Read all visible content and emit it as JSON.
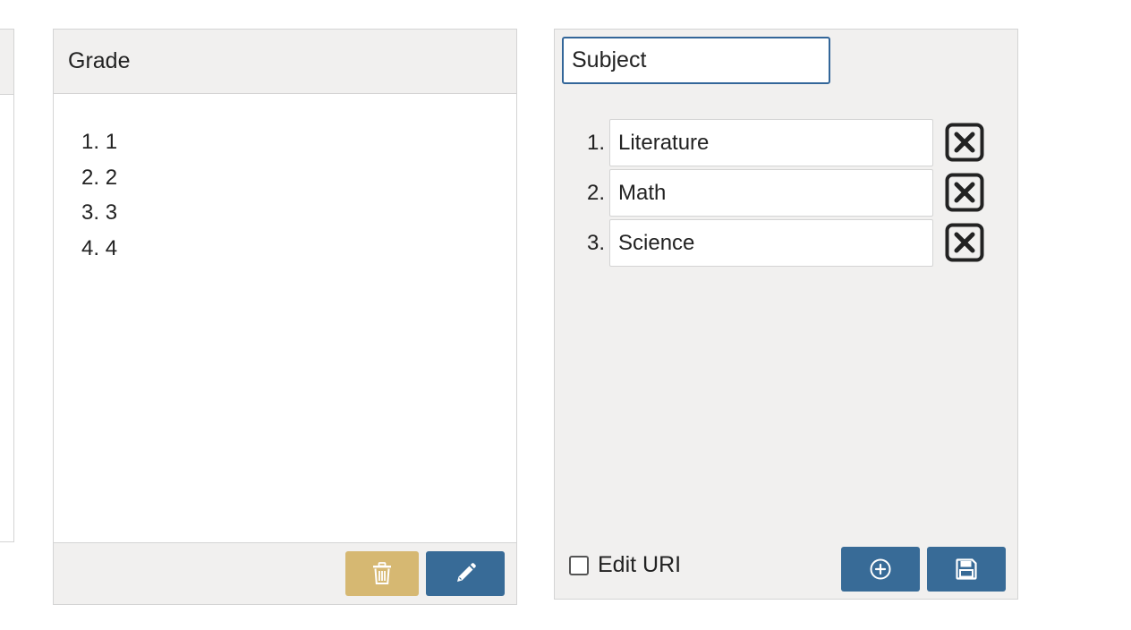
{
  "grade_panel": {
    "title": "Grade",
    "items": [
      {
        "number": "1.",
        "label": "1"
      },
      {
        "number": "2.",
        "label": "2"
      },
      {
        "number": "3.",
        "label": "3"
      },
      {
        "number": "4.",
        "label": "4"
      }
    ],
    "delete_icon": "trash-icon",
    "edit_icon": "pencil-icon"
  },
  "subject_panel": {
    "title_value": "Subject",
    "rows": [
      {
        "number": "1.",
        "value": "Literature"
      },
      {
        "number": "2.",
        "value": "Math"
      },
      {
        "number": "3.",
        "value": "Science"
      }
    ],
    "remove_icon": "close-box-icon",
    "edit_uri_label": "Edit URI",
    "edit_uri_checked": false,
    "add_icon": "plus-circle-icon",
    "save_icon": "floppy-disk-icon"
  },
  "colors": {
    "primary": "#386b97",
    "delete": "#d6b872",
    "panel_bg": "#f1f0ef",
    "border": "#d4d4d4",
    "input_focus": "#336699"
  }
}
